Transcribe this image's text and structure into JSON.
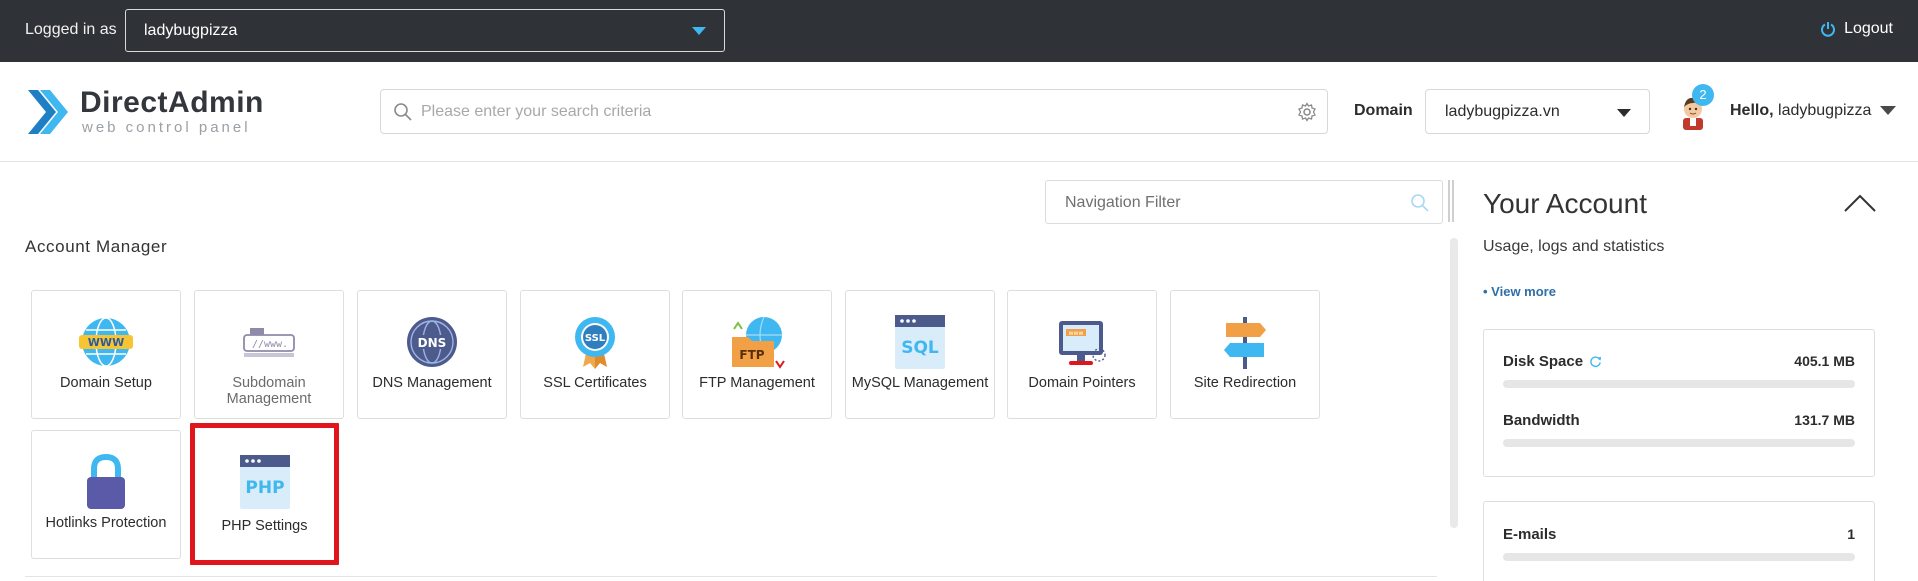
{
  "topbar": {
    "logged_in_label": "Logged in as",
    "user": "ladybugpizza",
    "logout_label": "Logout"
  },
  "header": {
    "brand": "DirectAdmin",
    "tagline": "web control panel",
    "search_placeholder": "Please enter your search criteria",
    "domain_label": "Domain",
    "domain_value": "ladybugpizza.vn",
    "notification_count": "2",
    "hello_prefix": "Hello,",
    "hello_user": "ladybugpizza"
  },
  "main": {
    "nav_filter_placeholder": "Navigation Filter",
    "section_title": "Account Manager",
    "tiles": [
      {
        "label": "Domain Setup",
        "icon": "www-globe-icon"
      },
      {
        "label": "Subdomain Management",
        "icon": "subdomain-icon"
      },
      {
        "label": "DNS Management",
        "icon": "dns-globe-icon"
      },
      {
        "label": "SSL Certificates",
        "icon": "ssl-badge-icon"
      },
      {
        "label": "FTP Management",
        "icon": "ftp-folder-icon"
      },
      {
        "label": "MySQL Management",
        "icon": "sql-window-icon"
      },
      {
        "label": "Domain Pointers",
        "icon": "monitor-pointer-icon"
      },
      {
        "label": "Site Redirection",
        "icon": "signpost-icon"
      },
      {
        "label": "Hotlinks Protection",
        "icon": "padlock-icon"
      },
      {
        "label": "PHP Settings",
        "icon": "php-window-icon"
      }
    ]
  },
  "account": {
    "title": "Your Account",
    "subtitle": "Usage, logs and statistics",
    "view_more": "• View more",
    "disk_space_label": "Disk Space",
    "disk_space_value": "405.1 MB",
    "bandwidth_label": "Bandwidth",
    "bandwidth_value": "131.7 MB",
    "emails_label": "E-mails",
    "emails_value": "1"
  },
  "colors": {
    "accent": "#3fb7f0",
    "topbar": "#2f3237",
    "highlight": "#e0161c"
  }
}
